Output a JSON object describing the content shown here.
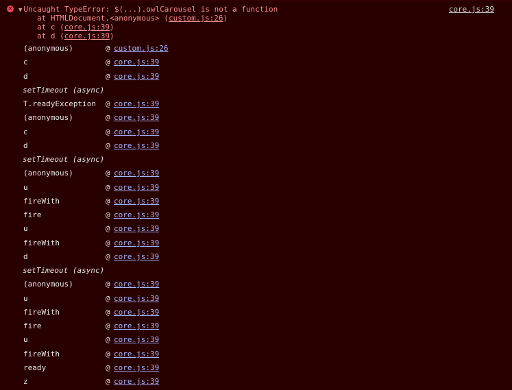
{
  "error": {
    "message": "Uncaught TypeError: $(...).owlCarousel is not a function",
    "source_link": "core.js:39",
    "stack": [
      {
        "prefix": "at HTMLDocument.<anonymous> (",
        "link": "custom.js:26",
        "suffix": ")"
      },
      {
        "prefix": "at c (",
        "link": "core.js:39",
        "suffix": ")"
      },
      {
        "prefix": "at d (",
        "link": "core.js:39",
        "suffix": ")"
      }
    ]
  },
  "frames": [
    {
      "type": "frame",
      "fn": "(anonymous)",
      "loc": "custom.js:26"
    },
    {
      "type": "frame",
      "fn": "c",
      "loc": "core.js:39"
    },
    {
      "type": "frame",
      "fn": "d",
      "loc": "core.js:39"
    },
    {
      "type": "async",
      "label": "setTimeout (async)"
    },
    {
      "type": "frame",
      "fn": "T.readyException",
      "loc": "core.js:39"
    },
    {
      "type": "frame",
      "fn": "(anonymous)",
      "loc": "core.js:39"
    },
    {
      "type": "frame",
      "fn": "c",
      "loc": "core.js:39"
    },
    {
      "type": "frame",
      "fn": "d",
      "loc": "core.js:39"
    },
    {
      "type": "async",
      "label": "setTimeout (async)"
    },
    {
      "type": "frame",
      "fn": "(anonymous)",
      "loc": "core.js:39"
    },
    {
      "type": "frame",
      "fn": "u",
      "loc": "core.js:39"
    },
    {
      "type": "frame",
      "fn": "fireWith",
      "loc": "core.js:39"
    },
    {
      "type": "frame",
      "fn": "fire",
      "loc": "core.js:39"
    },
    {
      "type": "frame",
      "fn": "u",
      "loc": "core.js:39"
    },
    {
      "type": "frame",
      "fn": "fireWith",
      "loc": "core.js:39"
    },
    {
      "type": "frame",
      "fn": "d",
      "loc": "core.js:39"
    },
    {
      "type": "async",
      "label": "setTimeout (async)"
    },
    {
      "type": "frame",
      "fn": "(anonymous)",
      "loc": "core.js:39"
    },
    {
      "type": "frame",
      "fn": "u",
      "loc": "core.js:39"
    },
    {
      "type": "frame",
      "fn": "fireWith",
      "loc": "core.js:39"
    },
    {
      "type": "frame",
      "fn": "fire",
      "loc": "core.js:39"
    },
    {
      "type": "frame",
      "fn": "u",
      "loc": "core.js:39"
    },
    {
      "type": "frame",
      "fn": "fireWith",
      "loc": "core.js:39"
    },
    {
      "type": "frame",
      "fn": "ready",
      "loc": "core.js:39"
    },
    {
      "type": "frame",
      "fn": "z",
      "loc": "core.js:39"
    }
  ],
  "at_symbol": "@",
  "icons": {
    "error": "error-circle-icon",
    "expand": "expand-triangle-icon"
  },
  "colors": {
    "background": "#290000",
    "error_text": "#f38d8d",
    "link": "#a5b4ff",
    "error_icon": "#e8485a"
  }
}
